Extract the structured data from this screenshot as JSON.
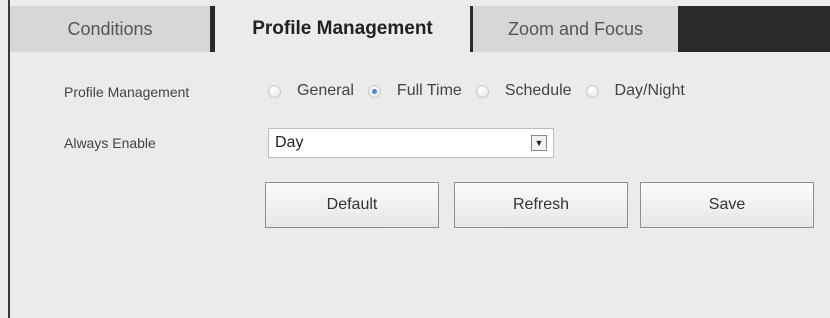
{
  "tabs": {
    "conditions": "Conditions",
    "profile_management": "Profile Management",
    "zoom_and_focus": "Zoom and Focus"
  },
  "profile_management": {
    "label": "Profile Management",
    "options": [
      "General",
      "Full Time",
      "Schedule",
      "Day/Night"
    ],
    "selected": "Full Time"
  },
  "always_enable": {
    "label": "Always Enable",
    "value": "Day"
  },
  "buttons": {
    "default": "Default",
    "refresh": "Refresh",
    "save": "Save"
  }
}
